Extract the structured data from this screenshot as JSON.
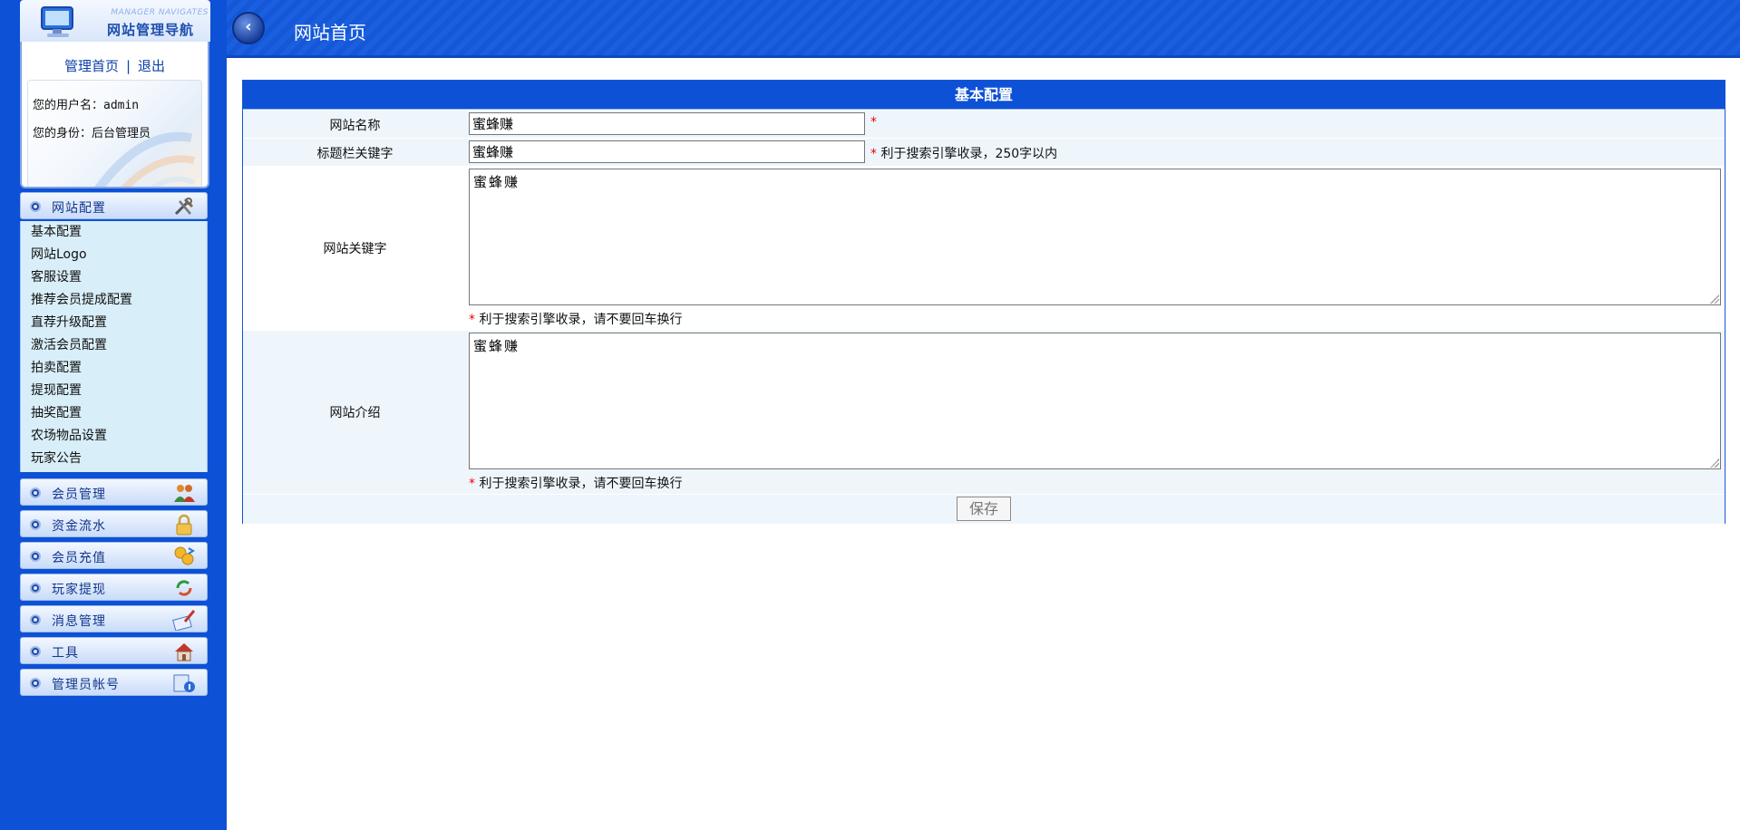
{
  "sidebar": {
    "header_en": "MANAGER NAVIGATES",
    "header_cn": "网站管理导航",
    "links": {
      "home": "管理首页",
      "separator": "|",
      "logout": "退出"
    },
    "user": {
      "username_line": "您的用户名：admin",
      "role_line": "您的身份：后台管理员"
    },
    "sections": [
      {
        "label": "网站配置",
        "icon": "tools-icon",
        "expanded": true
      },
      {
        "label": "会员管理",
        "icon": "users-icon"
      },
      {
        "label": "资金流水",
        "icon": "lock-icon"
      },
      {
        "label": "会员充值",
        "icon": "coins-icon"
      },
      {
        "label": "玩家提现",
        "icon": "withdraw-icon"
      },
      {
        "label": "消息管理",
        "icon": "message-icon"
      },
      {
        "label": "工具",
        "icon": "toolbox-icon"
      },
      {
        "label": "管理员帐号",
        "icon": "admin-account-icon"
      }
    ],
    "submenu": [
      "基本配置",
      "网站Logo",
      "客服设置",
      "推荐会员提成配置",
      "直荐升级配置",
      "激活会员配置",
      "拍卖配置",
      "提现配置",
      "抽奖配置",
      "农场物品设置",
      "玩家公告"
    ]
  },
  "topbar": {
    "title": "网站首页",
    "back_icon": "back-arrow-icon"
  },
  "form": {
    "title": "基本配置",
    "site_name": {
      "label": "网站名称",
      "value": "蜜蜂赚",
      "required_mark": "*"
    },
    "title_keywords": {
      "label": "标题栏关键字",
      "value": "蜜蜂赚",
      "required_mark": "*",
      "hint": "利于搜索引擎收录，250字以内"
    },
    "site_keywords": {
      "label": "网站关键字",
      "value": "蜜蜂赚",
      "required_mark": "*",
      "hint": "利于搜索引擎收录，请不要回车换行"
    },
    "site_intro": {
      "label": "网站介绍",
      "value": "蜜蜂赚",
      "required_mark": "*",
      "hint": "利于搜索引擎收录，请不要回车换行"
    },
    "save_label": "保存"
  },
  "colors": {
    "sidebar_bg": "#0d51d6",
    "panel_header": "#0d51d6",
    "row_alt": "#eef6fc",
    "required": "#e00000"
  }
}
